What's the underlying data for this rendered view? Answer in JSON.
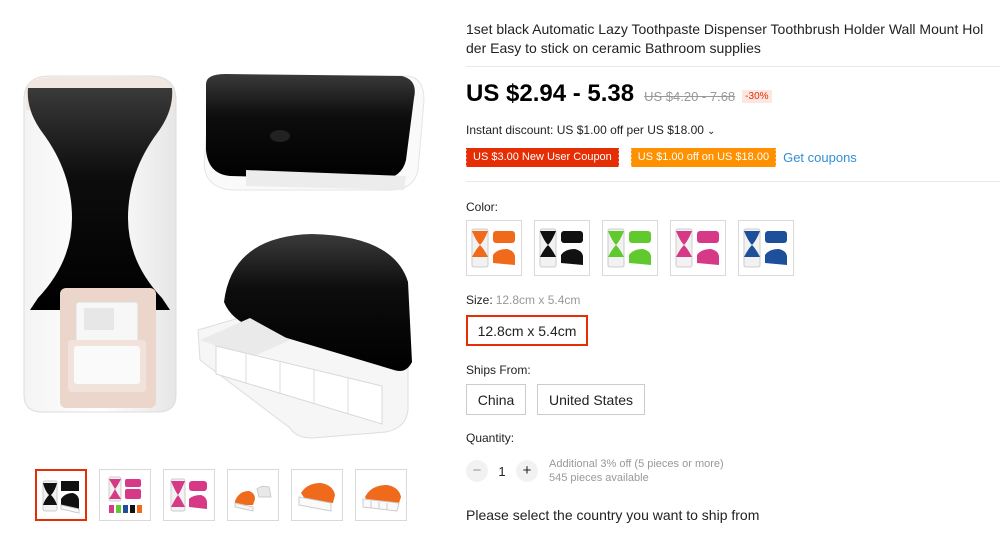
{
  "product": {
    "title": "1set black Automatic Lazy Toothpaste Dispenser Toothbrush Holder Wall Mount Hol\nder Easy to stick on ceramic Bathroom supplies",
    "price": "US $2.94 - 5.38",
    "old_price": "US $4.20 - 7.68",
    "discount": "-30%",
    "instant_discount": "Instant discount: US $1.00 off per US $18.00",
    "chevron": "⌄"
  },
  "coupons": {
    "new_user": "US $3.00 New User Coupon",
    "store": "US $1.00 off on US $18.00",
    "get": "Get coupons"
  },
  "color": {
    "label": "Color:",
    "options": [
      {
        "name": "orange",
        "accent": "#f06a1c"
      },
      {
        "name": "black",
        "accent": "#111111"
      },
      {
        "name": "green",
        "accent": "#5fc92e"
      },
      {
        "name": "pink",
        "accent": "#d63a86"
      },
      {
        "name": "blue",
        "accent": "#1e4f9b"
      }
    ]
  },
  "size": {
    "label": "Size:",
    "selected": "12.8cm x 5.4cm",
    "options": [
      "12.8cm x 5.4cm"
    ]
  },
  "ships_from": {
    "label": "Ships From:",
    "options": [
      "China",
      "United States"
    ]
  },
  "quantity": {
    "label": "Quantity:",
    "minus": "−",
    "plus": "+",
    "value": "1",
    "additional": "Additional 3% off (5 pieces or more)",
    "available": "545 pieces available"
  },
  "ship_note": "Please select the country you want to ship from",
  "colors": {
    "accent_red": "#e62e04",
    "accent_orange": "#ff9000",
    "link_blue": "#2f8fd8"
  }
}
